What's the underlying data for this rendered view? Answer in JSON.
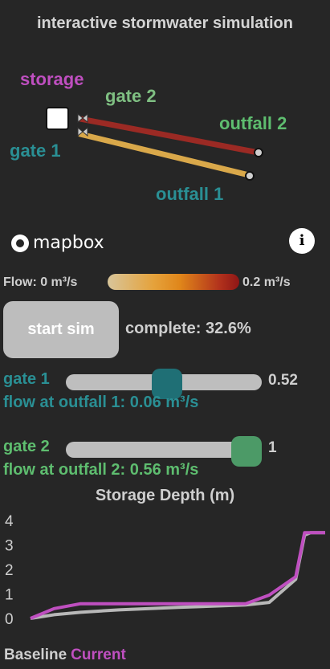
{
  "header": {
    "title": "interactive stormwater simulation"
  },
  "map": {
    "labels": {
      "storage": "storage",
      "gate2": "gate 2",
      "outfall2": "outfall 2",
      "gate1": "gate 1",
      "outfall1": "outfall 1"
    },
    "attribution": "mapbox",
    "info_icon": "i"
  },
  "flow_legend": {
    "min_label": "Flow: 0 m³/s",
    "max_label": "0.2 m³/s"
  },
  "sim": {
    "start_label": "start sim",
    "complete_text": "complete: 32.6%",
    "complete_fraction": 0.326
  },
  "gate1": {
    "label": "gate 1",
    "value": 0.52,
    "value_text": "0.52",
    "outfall_flow_text": "flow at outfall 1: 0.06 m³/s"
  },
  "gate2": {
    "label": "gate 2",
    "value": 1,
    "value_text": "1",
    "outfall_flow_text": "flow at outfall 2: 0.56 m³/s"
  },
  "colors": {
    "storage": "#bf4fc0",
    "gate1": "#2a8f94",
    "gate2": "#5ebd6f",
    "outfall1_line": "#d9a84a",
    "outfall2_line": "#9b2a24",
    "baseline": "#b8b8b8",
    "current": "#bf4fc0"
  },
  "chart_data": {
    "type": "line",
    "title": "Storage Depth (m)",
    "ylim": [
      0,
      4
    ],
    "yticks": [
      "4",
      "3",
      "2",
      "1",
      "0"
    ],
    "x": [
      0,
      0.08,
      0.17,
      0.3,
      0.5,
      0.73,
      0.81,
      0.9,
      0.93,
      0.95,
      1.0
    ],
    "series": [
      {
        "name": "Baseline",
        "values": [
          0,
          0.15,
          0.25,
          0.35,
          0.45,
          0.55,
          0.65,
          1.6,
          3.4,
          3.5,
          3.5
        ]
      },
      {
        "name": "Current",
        "values": [
          0,
          0.4,
          0.6,
          0.6,
          0.6,
          0.6,
          0.95,
          1.7,
          3.5,
          3.5,
          3.5
        ]
      }
    ],
    "legend": "bottom-left"
  }
}
